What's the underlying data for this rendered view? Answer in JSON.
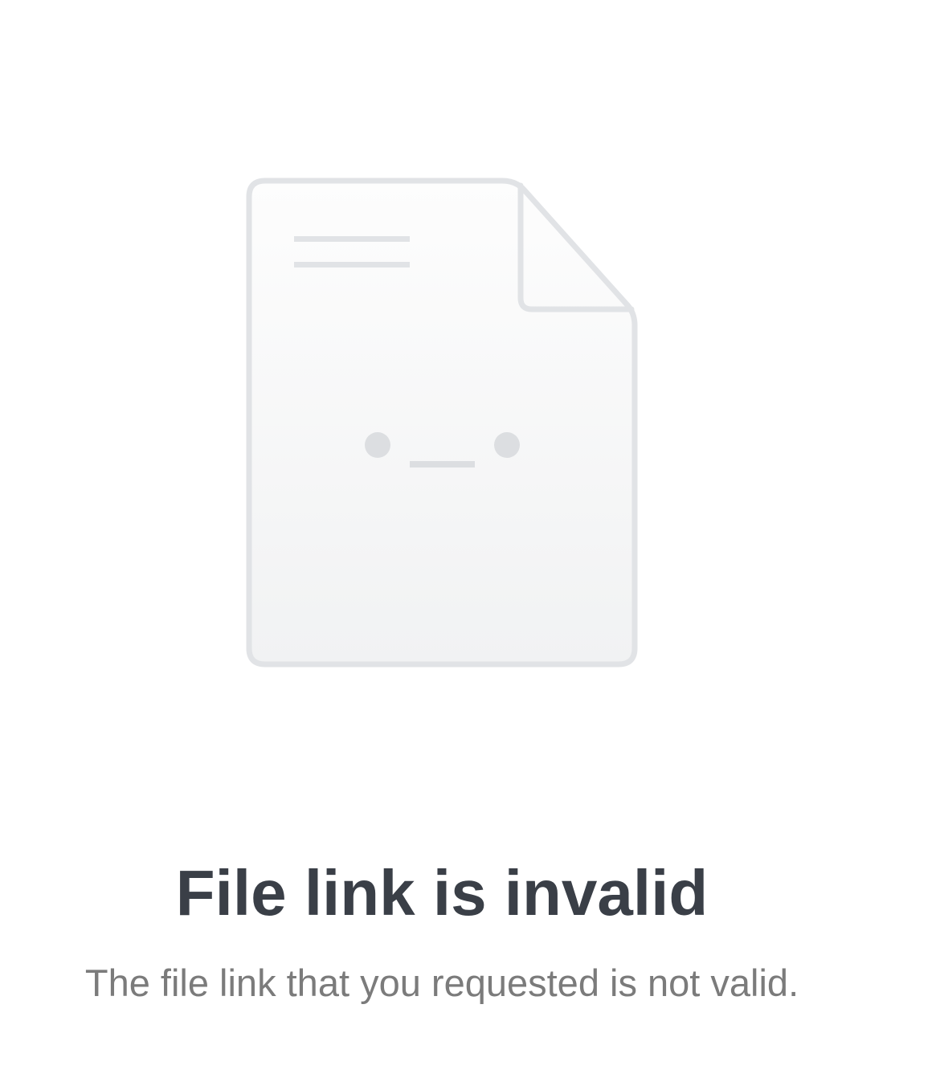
{
  "illustration": {
    "icon": "sad-document-icon",
    "colors": {
      "outline": "#e1e3e6",
      "fill_top": "#fdfdfd",
      "fill_bottom": "#f1f2f3",
      "features": "#dcdee1"
    }
  },
  "message": {
    "title": "File link is invalid",
    "description": "The file link that you requested is not valid."
  }
}
